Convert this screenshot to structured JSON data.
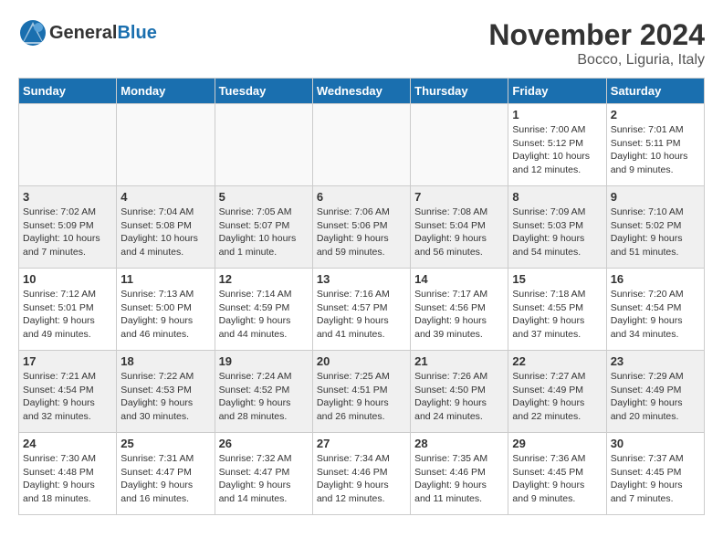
{
  "header": {
    "logo_general": "General",
    "logo_blue": "Blue",
    "title": "November 2024",
    "location": "Bocco, Liguria, Italy"
  },
  "weekdays": [
    "Sunday",
    "Monday",
    "Tuesday",
    "Wednesday",
    "Thursday",
    "Friday",
    "Saturday"
  ],
  "rows": [
    {
      "shade": "white",
      "cells": [
        {
          "day": "",
          "info": ""
        },
        {
          "day": "",
          "info": ""
        },
        {
          "day": "",
          "info": ""
        },
        {
          "day": "",
          "info": ""
        },
        {
          "day": "",
          "info": ""
        },
        {
          "day": "1",
          "info": "Sunrise: 7:00 AM\nSunset: 5:12 PM\nDaylight: 10 hours\nand 12 minutes."
        },
        {
          "day": "2",
          "info": "Sunrise: 7:01 AM\nSunset: 5:11 PM\nDaylight: 10 hours\nand 9 minutes."
        }
      ]
    },
    {
      "shade": "gray",
      "cells": [
        {
          "day": "3",
          "info": "Sunrise: 7:02 AM\nSunset: 5:09 PM\nDaylight: 10 hours\nand 7 minutes."
        },
        {
          "day": "4",
          "info": "Sunrise: 7:04 AM\nSunset: 5:08 PM\nDaylight: 10 hours\nand 4 minutes."
        },
        {
          "day": "5",
          "info": "Sunrise: 7:05 AM\nSunset: 5:07 PM\nDaylight: 10 hours\nand 1 minute."
        },
        {
          "day": "6",
          "info": "Sunrise: 7:06 AM\nSunset: 5:06 PM\nDaylight: 9 hours\nand 59 minutes."
        },
        {
          "day": "7",
          "info": "Sunrise: 7:08 AM\nSunset: 5:04 PM\nDaylight: 9 hours\nand 56 minutes."
        },
        {
          "day": "8",
          "info": "Sunrise: 7:09 AM\nSunset: 5:03 PM\nDaylight: 9 hours\nand 54 minutes."
        },
        {
          "day": "9",
          "info": "Sunrise: 7:10 AM\nSunset: 5:02 PM\nDaylight: 9 hours\nand 51 minutes."
        }
      ]
    },
    {
      "shade": "white",
      "cells": [
        {
          "day": "10",
          "info": "Sunrise: 7:12 AM\nSunset: 5:01 PM\nDaylight: 9 hours\nand 49 minutes."
        },
        {
          "day": "11",
          "info": "Sunrise: 7:13 AM\nSunset: 5:00 PM\nDaylight: 9 hours\nand 46 minutes."
        },
        {
          "day": "12",
          "info": "Sunrise: 7:14 AM\nSunset: 4:59 PM\nDaylight: 9 hours\nand 44 minutes."
        },
        {
          "day": "13",
          "info": "Sunrise: 7:16 AM\nSunset: 4:57 PM\nDaylight: 9 hours\nand 41 minutes."
        },
        {
          "day": "14",
          "info": "Sunrise: 7:17 AM\nSunset: 4:56 PM\nDaylight: 9 hours\nand 39 minutes."
        },
        {
          "day": "15",
          "info": "Sunrise: 7:18 AM\nSunset: 4:55 PM\nDaylight: 9 hours\nand 37 minutes."
        },
        {
          "day": "16",
          "info": "Sunrise: 7:20 AM\nSunset: 4:54 PM\nDaylight: 9 hours\nand 34 minutes."
        }
      ]
    },
    {
      "shade": "gray",
      "cells": [
        {
          "day": "17",
          "info": "Sunrise: 7:21 AM\nSunset: 4:54 PM\nDaylight: 9 hours\nand 32 minutes."
        },
        {
          "day": "18",
          "info": "Sunrise: 7:22 AM\nSunset: 4:53 PM\nDaylight: 9 hours\nand 30 minutes."
        },
        {
          "day": "19",
          "info": "Sunrise: 7:24 AM\nSunset: 4:52 PM\nDaylight: 9 hours\nand 28 minutes."
        },
        {
          "day": "20",
          "info": "Sunrise: 7:25 AM\nSunset: 4:51 PM\nDaylight: 9 hours\nand 26 minutes."
        },
        {
          "day": "21",
          "info": "Sunrise: 7:26 AM\nSunset: 4:50 PM\nDaylight: 9 hours\nand 24 minutes."
        },
        {
          "day": "22",
          "info": "Sunrise: 7:27 AM\nSunset: 4:49 PM\nDaylight: 9 hours\nand 22 minutes."
        },
        {
          "day": "23",
          "info": "Sunrise: 7:29 AM\nSunset: 4:49 PM\nDaylight: 9 hours\nand 20 minutes."
        }
      ]
    },
    {
      "shade": "white",
      "cells": [
        {
          "day": "24",
          "info": "Sunrise: 7:30 AM\nSunset: 4:48 PM\nDaylight: 9 hours\nand 18 minutes."
        },
        {
          "day": "25",
          "info": "Sunrise: 7:31 AM\nSunset: 4:47 PM\nDaylight: 9 hours\nand 16 minutes."
        },
        {
          "day": "26",
          "info": "Sunrise: 7:32 AM\nSunset: 4:47 PM\nDaylight: 9 hours\nand 14 minutes."
        },
        {
          "day": "27",
          "info": "Sunrise: 7:34 AM\nSunset: 4:46 PM\nDaylight: 9 hours\nand 12 minutes."
        },
        {
          "day": "28",
          "info": "Sunrise: 7:35 AM\nSunset: 4:46 PM\nDaylight: 9 hours\nand 11 minutes."
        },
        {
          "day": "29",
          "info": "Sunrise: 7:36 AM\nSunset: 4:45 PM\nDaylight: 9 hours\nand 9 minutes."
        },
        {
          "day": "30",
          "info": "Sunrise: 7:37 AM\nSunset: 4:45 PM\nDaylight: 9 hours\nand 7 minutes."
        }
      ]
    }
  ]
}
